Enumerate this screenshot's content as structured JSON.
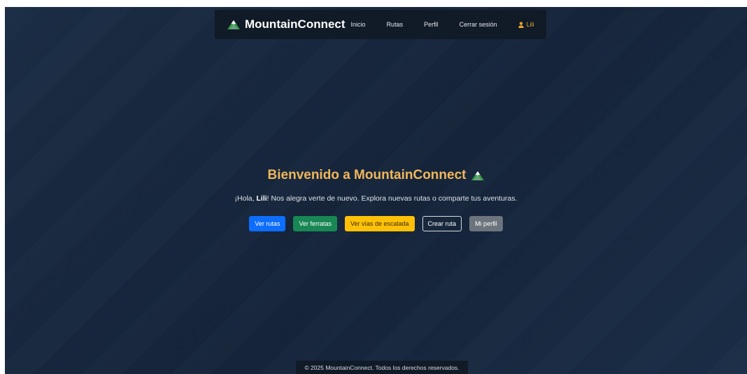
{
  "navbar": {
    "brand": "MountainConnect",
    "brand_icon": "mountain-icon",
    "links": {
      "inicio": "Inicio",
      "rutas": "Rutas",
      "perfil": "Perfil",
      "logout": "Cerrar sesión",
      "user": "Lili"
    },
    "user_icon": "user-icon"
  },
  "hero": {
    "title": "Bienvenido a MountainConnect",
    "title_icon": "mountain-icon",
    "greeting_prefix": "¡Hola, ",
    "user_name": "Lili",
    "greeting_suffix": "! Nos alegra verte de nuevo. Explora nuevas rutas o comparte tus aventuras."
  },
  "buttons": {
    "ver_rutas": "Ver rutas",
    "ver_ferratas": "Ver ferratas",
    "ver_escalada": "Ver vías de escalada",
    "crear_ruta": "Crear ruta",
    "mi_perfil": "Mi perfil"
  },
  "footer": {
    "text": "© 2025 MountainConnect. Todos los derechos reservados."
  },
  "colors": {
    "background": "#17273d",
    "navbar": "#111a27",
    "title": "#f0b75a",
    "user_link": "#e0a82e",
    "primary": "#0d6efd",
    "success": "#198754",
    "warning": "#ffc107",
    "secondary": "#6c757d"
  }
}
